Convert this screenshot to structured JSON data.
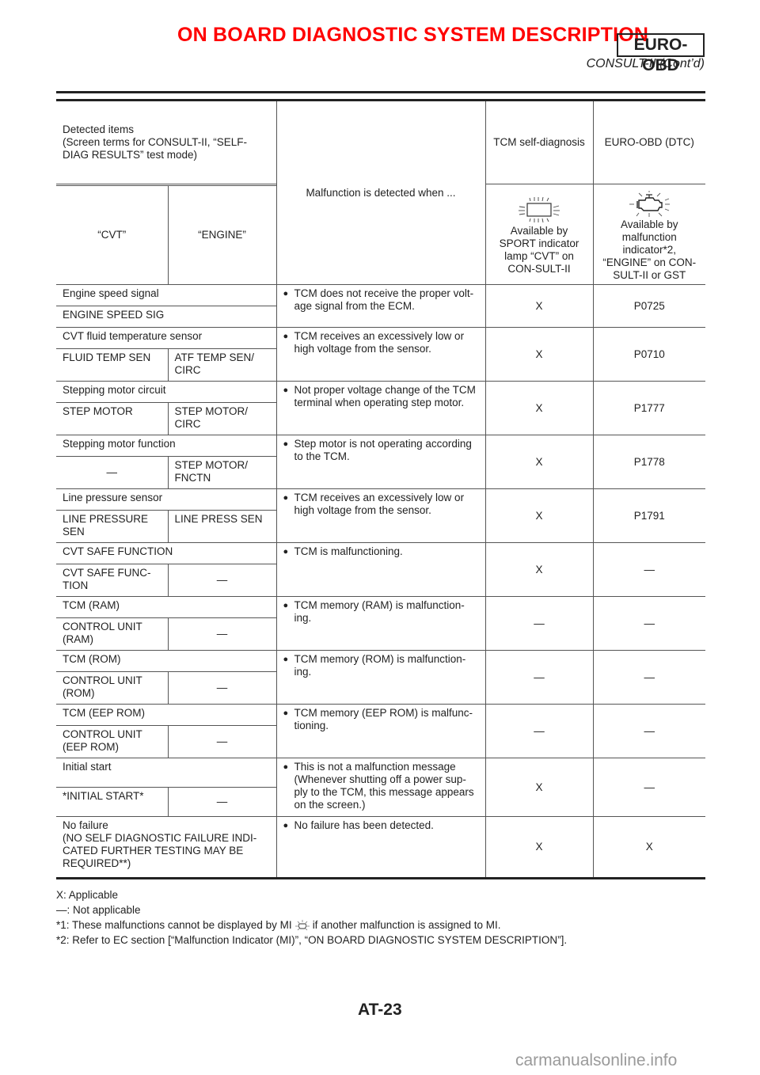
{
  "header": {
    "title": "ON BOARD DIAGNOSTIC SYSTEM DESCRIPTION",
    "badge": "EURO-OBD",
    "subtitle": "CONSULT-II (Cont’d)",
    "title_color": "#ff0000"
  },
  "table": {
    "headers": {
      "detected_items": "Detected items\n(Screen terms for CONSULT-II, “SELF-DIAG RESULTS” test mode)",
      "cvt": "“CVT”",
      "engine": "“ENGINE”",
      "malfunction": "Malfunction is detected when ...",
      "tcm_self_diag": "TCM self-diagnosis",
      "euro_obd": "EURO-OBD (DTC)",
      "tcm_icon": "sport-indicator-lamp-icon",
      "tcm_desc": "Available by SPORT indicator lamp “CVT” on CON-SULT-II",
      "obd_icon": "malfunction-indicator-engine-icon",
      "obd_desc": "Available by malfunction indicator*2, “ENGINE” on CON-SULT-II or GST"
    },
    "rows": [
      {
        "item": "Engine speed signal",
        "cvt": "ENGINE SPEED SIG",
        "engine": null,
        "malfunction": "TCM does not receive the proper volt-age signal from the ECM.",
        "tcm": "X",
        "dtc": "P0725"
      },
      {
        "item": "CVT fluid temperature sensor",
        "cvt": "FLUID TEMP SEN",
        "engine": "ATF TEMP SEN/ CIRC",
        "malfunction": "TCM receives an excessively low or high voltage from the sensor.",
        "tcm": "X",
        "dtc": "P0710"
      },
      {
        "item": "Stepping motor circuit",
        "cvt": "STEP MOTOR",
        "engine": "STEP MOTOR/ CIRC",
        "malfunction": "Not proper voltage change of the TCM terminal when operating step motor.",
        "tcm": "X",
        "dtc": "P1777"
      },
      {
        "item": "Stepping motor function",
        "cvt": "—",
        "engine": "STEP MOTOR/ FNCTN",
        "malfunction": "Step motor is not operating according to the TCM.",
        "tcm": "X",
        "dtc": "P1778"
      },
      {
        "item": "Line pressure sensor",
        "cvt": "LINE PRESSURE SEN",
        "engine": "LINE PRESS SEN",
        "malfunction": "TCM receives an excessively low or high voltage from the sensor.",
        "tcm": "X",
        "dtc": "P1791"
      },
      {
        "item": "CVT SAFE FUNCTION",
        "cvt": "CVT SAFE FUNC-TION",
        "engine": "—",
        "malfunction": "TCM is malfunctioning.",
        "tcm": "X",
        "dtc": "—"
      },
      {
        "item": "TCM (RAM)",
        "cvt": "CONTROL UNIT (RAM)",
        "engine": "—",
        "malfunction": "TCM memory (RAM) is malfunction-ing.",
        "tcm": "—",
        "dtc": "—"
      },
      {
        "item": "TCM (ROM)",
        "cvt": "CONTROL UNIT (ROM)",
        "engine": "—",
        "malfunction": "TCM memory (ROM) is malfunction-ing.",
        "tcm": "—",
        "dtc": "—"
      },
      {
        "item": "TCM (EEP ROM)",
        "cvt": "CONTROL UNIT (EEP ROM)",
        "engine": "—",
        "malfunction": "TCM memory (EEP ROM) is malfunc-tioning.",
        "tcm": "—",
        "dtc": "—"
      },
      {
        "item": "Initial start",
        "cvt": "*INITIAL START*",
        "engine": "—",
        "malfunction": "This is not a malfunction message (Whenever shutting off a power sup-ply to the TCM, this message appears on the screen.)",
        "tcm": "X",
        "dtc": "—"
      },
      {
        "item": "No failure\n(NO SELF DIAGNOSTIC FAILURE INDI-CATED FURTHER TESTING MAY BE REQUIRED**)",
        "malfunction": "No failure has been detected.",
        "tcm": "X",
        "dtc": "X"
      }
    ]
  },
  "notes": {
    "x": "X: Applicable",
    "dash": "—: Not applicable",
    "n1_pre": "*1: These malfunctions cannot be displayed by MI",
    "n1_icon": "mi-lamp-icon",
    "n1_post": "if another malfunction is assigned to MI.",
    "n2": "*2: Refer to EC section [“Malfunction Indicator (MI)”, “ON BOARD DIAGNOSTIC SYSTEM DESCRIPTION”]."
  },
  "footer": {
    "page_number": "AT-23",
    "watermark": "carmanualsonline.info"
  }
}
